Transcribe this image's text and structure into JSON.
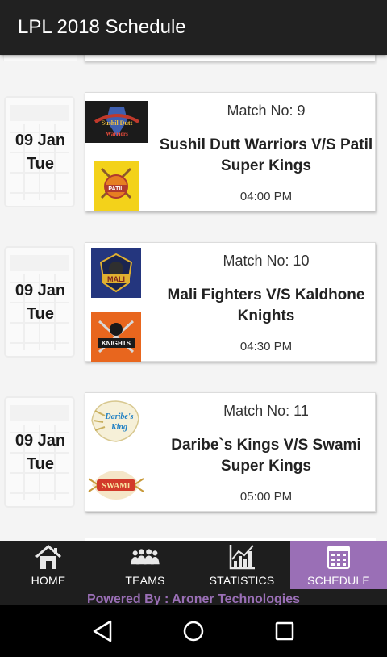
{
  "app": {
    "title": "LPL 2018 Schedule"
  },
  "matches": [
    {
      "date": "09 Jan",
      "day": "Tue",
      "match_no": "Match No: 9",
      "teams": "Sushil Dutt Warriors V/S Patil Super Kings",
      "time": "04:00 PM",
      "logo_top": {
        "icon": "sushil-dutt-warriors-logo",
        "text": "Sushil Dutt Warriors",
        "bg": "#1b1b1b",
        "accent": "#c0392b"
      },
      "logo_bottom": {
        "icon": "patil-super-kings-logo",
        "text": "PATIL",
        "bg": "#f3d21a",
        "accent": "#c0392b"
      }
    },
    {
      "date": "09 Jan",
      "day": "Tue",
      "match_no": "Match No: 10",
      "teams": "Mali Fighters V/S Kaldhone Knights",
      "time": "04:30 PM",
      "logo_top": {
        "icon": "mali-fighters-logo",
        "text": "MALI",
        "bg": "#24367e",
        "accent": "#e0b030"
      },
      "logo_bottom": {
        "icon": "kaldhone-knights-logo",
        "text": "KNIGHTS",
        "bg": "#e8661e",
        "accent": "#1a1a1a"
      }
    },
    {
      "date": "09 Jan",
      "day": "Tue",
      "match_no": "Match No: 11",
      "teams": "Daribe`s Kings V/S Swami Super Kings",
      "time": "05:00 PM",
      "logo_top": {
        "icon": "daribes-kings-logo",
        "text": "Daribe's King",
        "bg": "#ffffff",
        "accent": "#1f7fc4"
      },
      "logo_bottom": {
        "icon": "swami-super-kings-logo",
        "text": "SWAMI",
        "bg": "#ffffff",
        "accent": "#d23a2a"
      }
    }
  ],
  "nav": {
    "items": [
      {
        "label": "HOME",
        "icon": "home-icon"
      },
      {
        "label": "TEAMS",
        "icon": "teams-icon"
      },
      {
        "label": "STATISTICS",
        "icon": "statistics-icon"
      },
      {
        "label": "SCHEDULE",
        "icon": "schedule-icon",
        "active": true
      }
    ],
    "active_color": "#9a6fb6",
    "bar_color": "#1e1e1e"
  },
  "footer": {
    "powered": "Powered By : Aroner Technologies"
  },
  "colors": {
    "appbar": "#212121",
    "brand": "#9a6fb6"
  }
}
